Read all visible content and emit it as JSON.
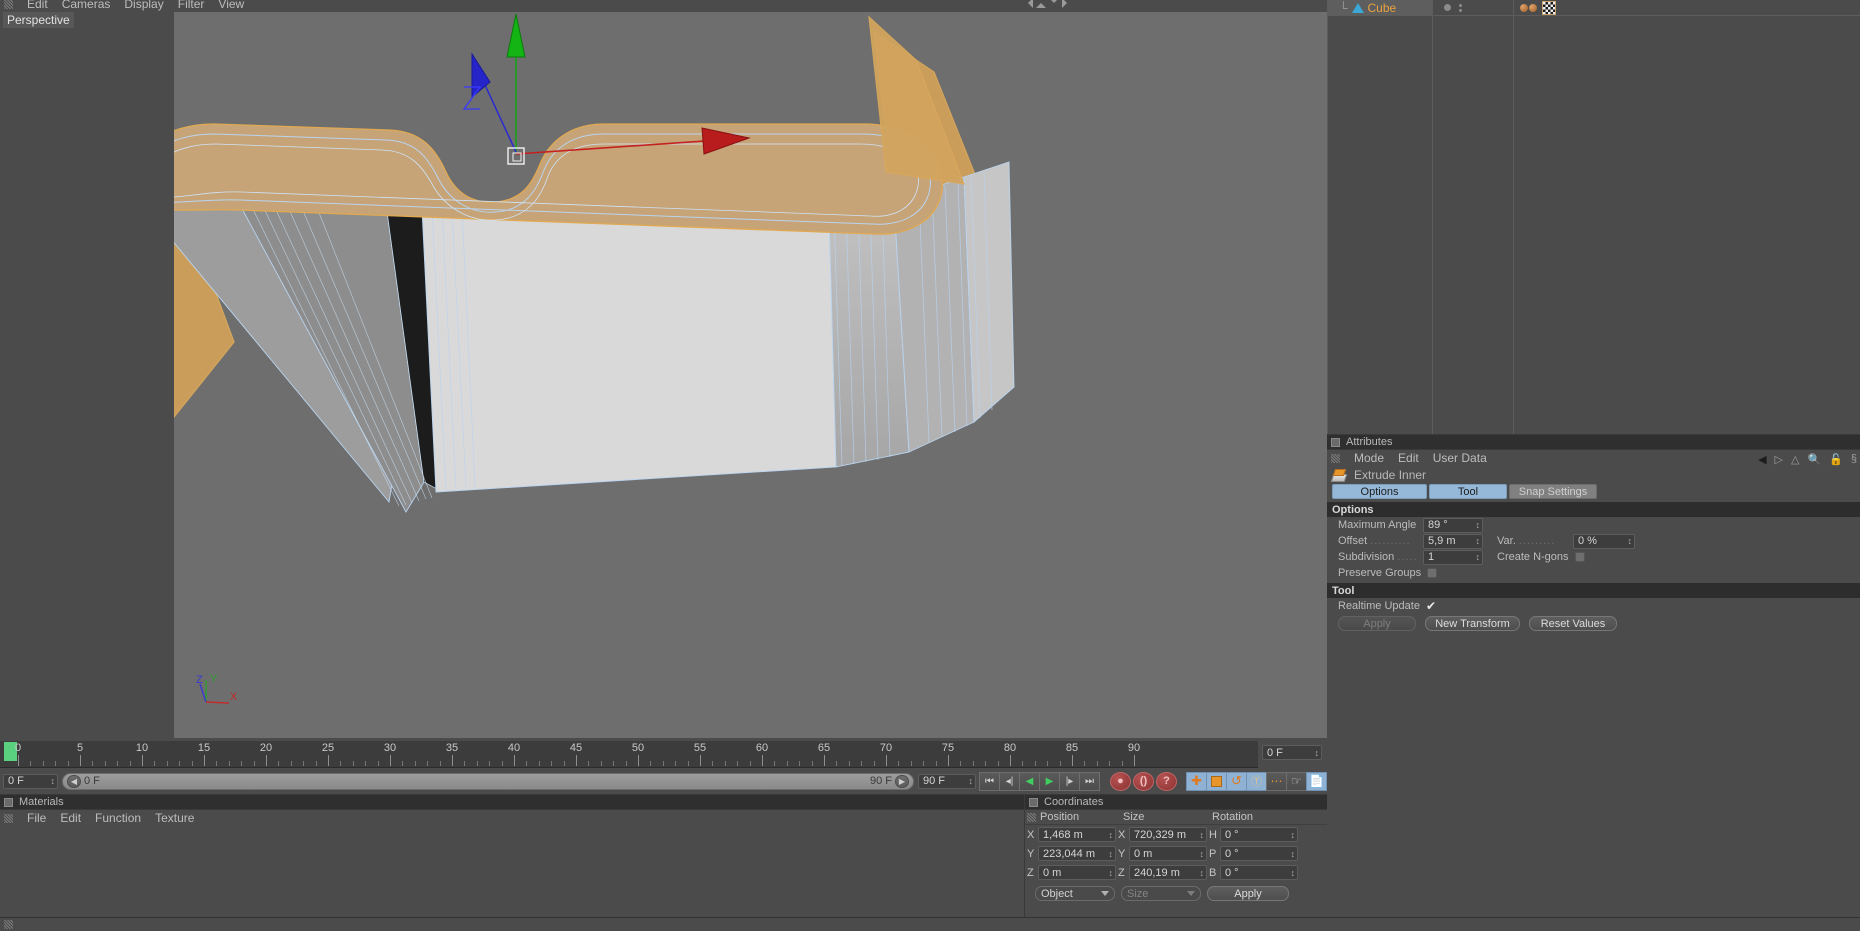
{
  "viewport": {
    "menu": [
      "Edit",
      "Cameras",
      "Display",
      "Filter",
      "View"
    ],
    "label": "Perspective",
    "axis_gizmo": {
      "x": "X",
      "y": "Y",
      "z": "Z"
    },
    "gizmo_axes": {
      "x_color": "#cc2b2b",
      "y_color": "#1faa1f",
      "z_color": "#2b2bcc"
    },
    "object_colors": {
      "top_face": "#c9a87a",
      "side_face": "#b8b8b8",
      "wireframe": "#b9d4ef",
      "outline": "#e0a952"
    }
  },
  "timeline": {
    "ticks": [
      "0",
      "5",
      "10",
      "15",
      "20",
      "25",
      "30",
      "35",
      "40",
      "45",
      "50",
      "55",
      "60",
      "65",
      "70",
      "75",
      "80",
      "85",
      "90"
    ],
    "current_frame_right": "0 F",
    "frame_start": "0 F",
    "scrub_left": "0 F",
    "scrub_right": "90 F",
    "frame_end": "90 F",
    "transport": [
      "go-to-start",
      "step-back",
      "play-reverse",
      "play-forward",
      "step-forward",
      "go-to-end"
    ],
    "record_buttons": [
      "record-icon",
      "autokey-icon",
      "keyframe-selection-icon"
    ],
    "mode_buttons": [
      "position-icon",
      "scale-icon",
      "rotation-icon",
      "parameter-icon",
      "point-level-icon",
      "animate-icon",
      "keyframe-icon"
    ]
  },
  "materials": {
    "title": "Materials",
    "menu": [
      "File",
      "Edit",
      "Function",
      "Texture"
    ]
  },
  "statusbar": {
    "text": ""
  },
  "object_manager": {
    "object_name": "Cube",
    "icons": [
      "object-tag-sphere",
      "texture-tag-checker"
    ]
  },
  "attributes": {
    "title": "Attributes",
    "menu": [
      "Mode",
      "Edit",
      "User Data"
    ],
    "header_icons": [
      "back-arrow-icon",
      "forward-arrow-icon",
      "up-arrow-icon",
      "search-icon",
      "lock-icon",
      "link-icon"
    ],
    "object": "Extrude Inner",
    "tabs": [
      {
        "label": "Options",
        "active": true
      },
      {
        "label": "Tool",
        "active": true
      },
      {
        "label": "Snap Settings",
        "active": false
      }
    ],
    "sections": {
      "options": {
        "heading": "Options",
        "maximum_angle": {
          "label": "Maximum Angle",
          "value": "89 °"
        },
        "offset": {
          "label": "Offset",
          "value": "5,9 m"
        },
        "variation": {
          "label": "Var.",
          "value": "0 %"
        },
        "subdivision": {
          "label": "Subdivision",
          "value": "1"
        },
        "create_ngons": {
          "label": "Create N-gons",
          "checked": false
        },
        "preserve_groups": {
          "label": "Preserve Groups",
          "checked": false
        }
      },
      "tool": {
        "heading": "Tool",
        "realtime_update": {
          "label": "Realtime Update",
          "checked": true
        },
        "apply": "Apply",
        "new_transform": "New Transform",
        "reset_values": "Reset Values"
      }
    }
  },
  "coordinates": {
    "title": "Coordinates",
    "columns": [
      "Position",
      "Size",
      "Rotation"
    ],
    "position": {
      "x": "1,468 m",
      "y": "223,044 m",
      "z": "0 m"
    },
    "size": {
      "x": "720,329 m",
      "y": "0 m",
      "z": "240,19 m"
    },
    "rotation": {
      "h": "0 °",
      "p": "0 °",
      "b": "0 °"
    },
    "axis_labels": {
      "px": "X",
      "py": "Y",
      "pz": "Z",
      "sx": "X",
      "sy": "Y",
      "sz": "Z",
      "rh": "H",
      "rp": "P",
      "rb": "B"
    },
    "mode_select": "Object",
    "size_select": "Size",
    "apply": "Apply"
  }
}
